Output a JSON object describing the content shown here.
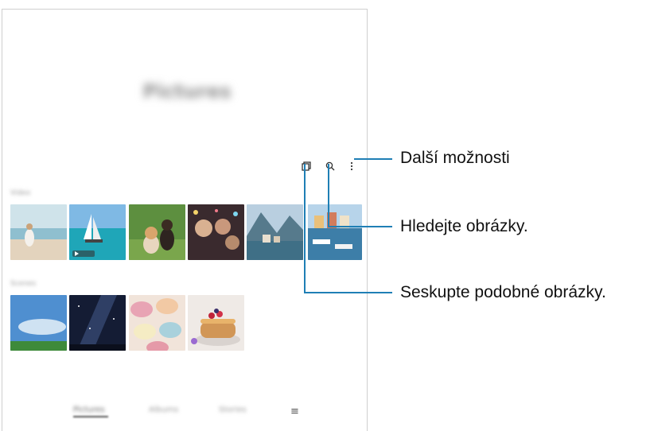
{
  "gallery": {
    "title": "Pictures",
    "sections": [
      {
        "label": "Video"
      },
      {
        "label": "Scenes"
      }
    ],
    "toolbar": {
      "group_icon": "copy-icon",
      "search_icon": "search-icon",
      "more_icon": "more-vertical-icon"
    },
    "nav": {
      "pictures": "Pictures",
      "albums": "Albums",
      "stories": "Stories",
      "menu_glyph": "≡"
    }
  },
  "callouts": {
    "more_options": "Další možnosti",
    "search_pictures": "Hledejte obrázky.",
    "group_similar": "Seskupte podobné obrázky."
  },
  "colors": {
    "leader_line": "#1f7fb5"
  }
}
